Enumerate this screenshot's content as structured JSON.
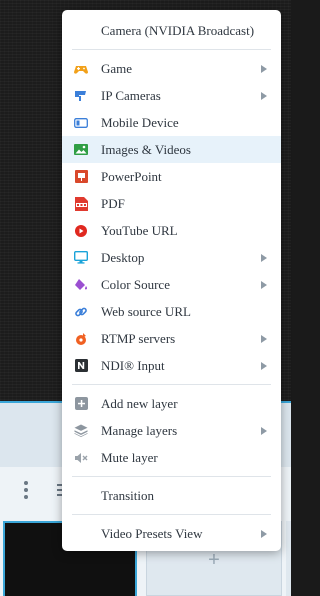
{
  "menu": {
    "header_item": "Camera (NVIDIA Broadcast)",
    "sources": [
      {
        "label": "Game",
        "icon": "gamepad-icon",
        "submenu": true
      },
      {
        "label": "IP Cameras",
        "icon": "ip-camera-icon",
        "submenu": true
      },
      {
        "label": "Mobile Device",
        "icon": "mobile-device-icon",
        "submenu": false
      },
      {
        "label": "Images & Videos",
        "icon": "image-icon",
        "submenu": false
      },
      {
        "label": "PowerPoint",
        "icon": "powerpoint-icon",
        "submenu": false
      },
      {
        "label": "PDF",
        "icon": "pdf-icon",
        "submenu": false
      },
      {
        "label": "YouTube URL",
        "icon": "youtube-icon",
        "submenu": false
      },
      {
        "label": "Desktop",
        "icon": "monitor-icon",
        "submenu": true
      },
      {
        "label": "Color Source",
        "icon": "paint-bucket-icon",
        "submenu": true
      },
      {
        "label": "Web source URL",
        "icon": "link-icon",
        "submenu": false
      },
      {
        "label": "RTMP servers",
        "icon": "rtmp-icon",
        "submenu": true
      },
      {
        "label": "NDI® Input",
        "icon": "ndi-icon",
        "submenu": true
      }
    ],
    "layer_items": [
      {
        "label": "Add new layer",
        "icon": "add-square-icon",
        "submenu": false
      },
      {
        "label": "Manage layers",
        "icon": "layers-icon",
        "submenu": true
      },
      {
        "label": "Mute layer",
        "icon": "mute-icon",
        "submenu": false
      }
    ],
    "transition": "Transition",
    "presets": "Video Presets View",
    "highlighted_item": "Images & Videos"
  },
  "background": {
    "add_tile_symbol": "+"
  },
  "colors": {
    "accent": "#3aa6d8",
    "highlight": "#e7f2fa"
  }
}
